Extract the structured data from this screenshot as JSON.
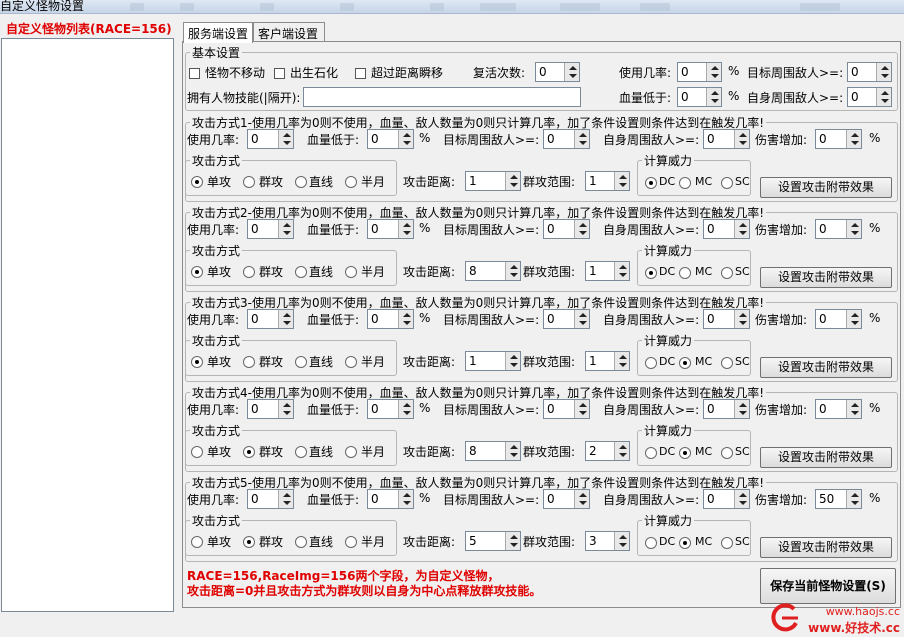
{
  "window": {
    "title": "自定义怪物设置"
  },
  "left_panel": {
    "title": "自定义怪物列表(RACE=156)"
  },
  "tabs": [
    {
      "label": "服务端设置",
      "active": true
    },
    {
      "label": "客户端设置",
      "active": false
    }
  ],
  "basic": {
    "legend": "基本设置",
    "checkboxes": [
      {
        "label": "怪物不移动",
        "checked": false
      },
      {
        "label": "出生石化",
        "checked": false
      },
      {
        "label": "超过距离瞬移",
        "checked": false
      }
    ],
    "revive_label": "复活次数:",
    "revive_value": "0",
    "use_rate_label": "使用几率:",
    "use_rate_value": "0",
    "target_enemy_label": "目标周围敌人>=:",
    "target_enemy_value": "0",
    "skills_label": "拥有人物技能(|隔开):",
    "skills_value": "",
    "hp_low_label": "血量低于:",
    "hp_low_value": "0",
    "self_enemy_label": "自身周围敌人>=:",
    "self_enemy_value": "0",
    "percent": "%"
  },
  "labels": {
    "use_rate": "使用几率:",
    "hp_low": "血量低于:",
    "target_enemy": "目标周围敌人>=:",
    "self_enemy": "自身周围敌人>=:",
    "damage_add": "伤害增加:",
    "percent": "%",
    "attack_mode": "攻击方式",
    "distance": "攻击距离:",
    "range": "群攻范围:",
    "power": "计算威力",
    "effect_button": "设置攻击附带效果",
    "modes": [
      "单攻",
      "群攻",
      "直线",
      "半月"
    ],
    "powers": [
      "DC",
      "MC",
      "SC"
    ]
  },
  "attacks": [
    {
      "legend": "攻击方式1-使用几率为0则不使用，血量、敌人数量为0则只计算几率，加了条件设置则条件达到在触发几率!",
      "use_rate": "0",
      "hp_low": "0",
      "target_enemy": "0",
      "self_enemy": "0",
      "damage_add": "0",
      "mode": 0,
      "distance": "1",
      "range": "1",
      "power": 0
    },
    {
      "legend": "攻击方式2-使用几率为0则不使用，血量、敌人数量为0则只计算几率，加了条件设置则条件达到在触发几率!",
      "use_rate": "0",
      "hp_low": "0",
      "target_enemy": "0",
      "self_enemy": "0",
      "damage_add": "0",
      "mode": 0,
      "distance": "8",
      "range": "1",
      "power": 0
    },
    {
      "legend": "攻击方式3-使用几率为0则不使用，血量、敌人数量为0则只计算几率，加了条件设置则条件达到在触发几率!",
      "use_rate": "0",
      "hp_low": "0",
      "target_enemy": "0",
      "self_enemy": "0",
      "damage_add": "0",
      "mode": 0,
      "distance": "1",
      "range": "1",
      "power": 1
    },
    {
      "legend": "攻击方式4-使用几率为0则不使用，血量、敌人数量为0则只计算几率，加了条件设置则条件达到在触发几率!",
      "use_rate": "0",
      "hp_low": "0",
      "target_enemy": "0",
      "self_enemy": "0",
      "damage_add": "0",
      "mode": 1,
      "distance": "8",
      "range": "2",
      "power": 1
    },
    {
      "legend": "攻击方式5-使用几率为0则不使用，血量、敌人数量为0则只计算几率，加了条件设置则条件达到在触发几率!",
      "use_rate": "0",
      "hp_low": "0",
      "target_enemy": "0",
      "self_enemy": "0",
      "damage_add": "50",
      "mode": 1,
      "distance": "5",
      "range": "3",
      "power": 1
    }
  ],
  "notes": [
    "RACE=156,RaceImg=156两个字段，为自定义怪物，",
    "攻击距离=0并且攻击方式为群攻则以自身为中心点释放群攻技能。"
  ],
  "save_button": "保存当前怪物设置(S)",
  "watermark": {
    "line1": "www.haojs.cc",
    "line2": "www.好技术.cc"
  },
  "colors": {
    "accent_red": "#e00000",
    "list_bg": "#ffffff",
    "window_bg": "#f0f0f0"
  }
}
